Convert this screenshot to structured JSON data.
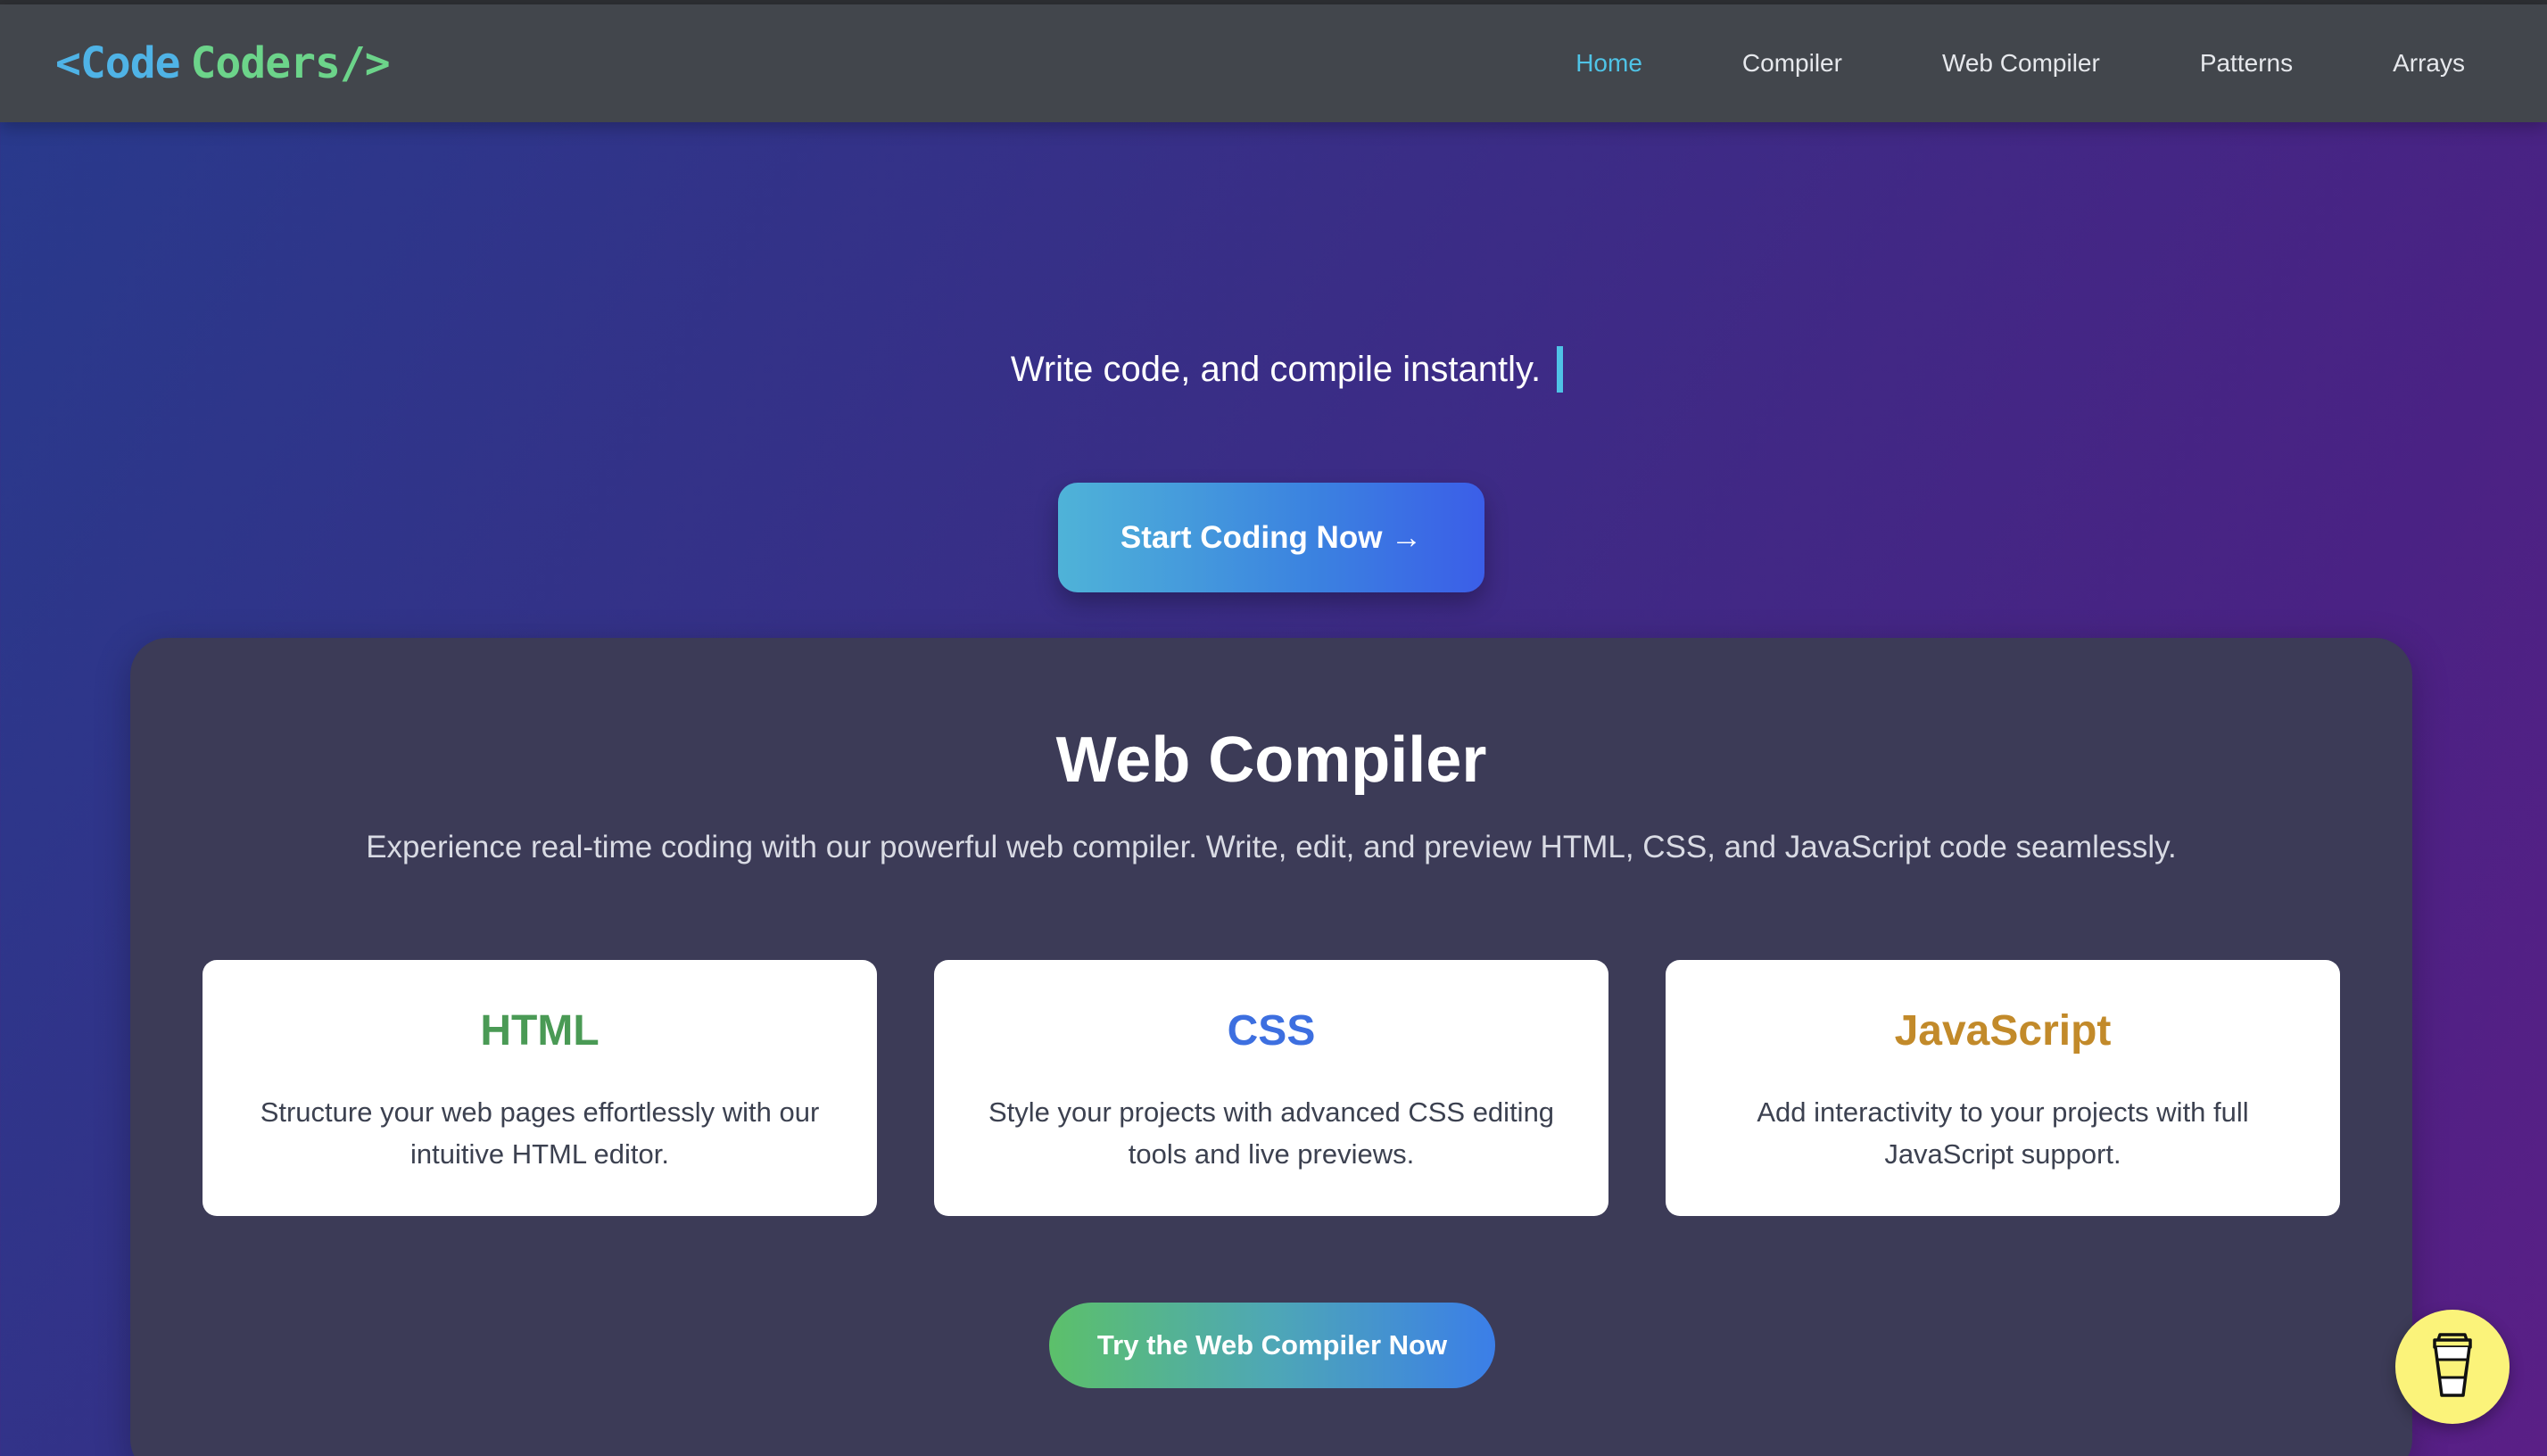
{
  "colors": {
    "accent": "#4fc3e6",
    "nav_bg": "#42464c",
    "panel_bg": "#3c3b57",
    "html_color": "#4a9a55",
    "css_color": "#3d6fe0",
    "js_color": "#c28a2a",
    "coffee_bg": "#fbf37a"
  },
  "logo": {
    "open": "<",
    "word1": "Code",
    "word2": "Coders",
    "close": "/>"
  },
  "nav": {
    "items": [
      {
        "label": "Home",
        "active": true
      },
      {
        "label": "Compiler",
        "active": false
      },
      {
        "label": "Web Compiler",
        "active": false
      },
      {
        "label": "Patterns",
        "active": false
      },
      {
        "label": "Arrays",
        "active": false
      }
    ]
  },
  "hero": {
    "tagline": "Write code, and compile instantly.",
    "cta_label": "Start Coding Now →"
  },
  "web_compiler": {
    "title": "Web Compiler",
    "subtitle": "Experience real-time coding with our powerful web compiler. Write, edit, and preview HTML, CSS, and JavaScript code seamlessly.",
    "cards": [
      {
        "title": "HTML",
        "description": "Structure your web pages effortlessly with our intuitive HTML editor."
      },
      {
        "title": "CSS",
        "description": "Style your projects with advanced CSS editing tools and live previews."
      },
      {
        "title": "JavaScript",
        "description": "Add interactivity to your projects with full JavaScript support."
      }
    ],
    "cta_label": "Try the Web Compiler Now"
  },
  "floating": {
    "icon": "coffee-cup-icon"
  }
}
